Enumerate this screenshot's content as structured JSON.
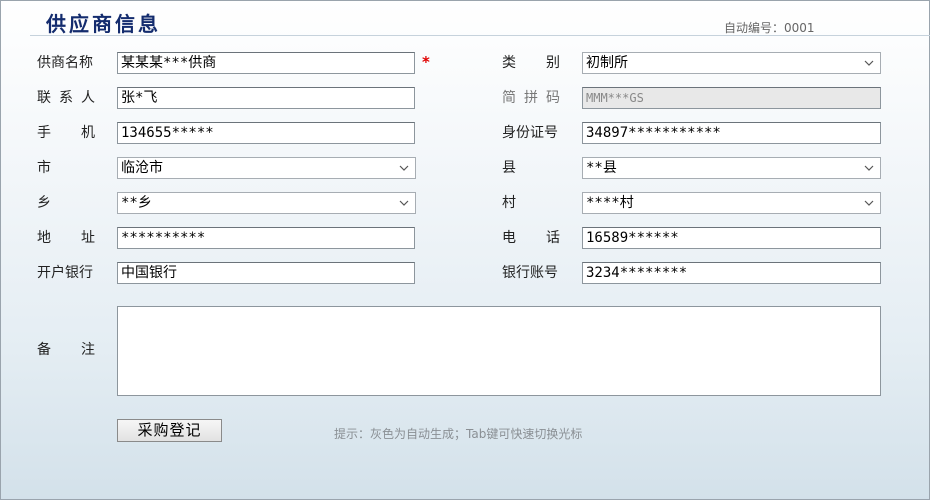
{
  "header": {
    "title": "供应商信息",
    "auto_number": "自动编号：0001"
  },
  "form": {
    "supplier_name": {
      "label": "供商名称",
      "value": "某某某***供商",
      "required_mark": "*"
    },
    "category": {
      "label": "类　别",
      "value": "初制所"
    },
    "contact": {
      "label": "联系人",
      "value": "张*飞"
    },
    "pinyin_code": {
      "label": "简拼码",
      "value": "MMM***GS"
    },
    "mobile": {
      "label": "手机",
      "value": "134655*****"
    },
    "id_number": {
      "label": "身份证号",
      "value": "34897***********"
    },
    "city": {
      "label": "市",
      "value": "临沧市"
    },
    "county": {
      "label": "县",
      "value": "**县"
    },
    "township": {
      "label": "乡",
      "value": "**乡"
    },
    "village": {
      "label": "村",
      "value": "****村"
    },
    "address": {
      "label": "地址",
      "value": "**********"
    },
    "phone": {
      "label": "电话",
      "value": "16589******"
    },
    "bank": {
      "label": "开户银行",
      "value": "中国银行"
    },
    "bank_account": {
      "label": "银行账号",
      "value": "3234********"
    },
    "remark": {
      "label": "备注",
      "value": ""
    }
  },
  "actions": {
    "register_label": "采购登记"
  },
  "tip": "提示：灰色为自动生成；Tab键可快速切换光标"
}
